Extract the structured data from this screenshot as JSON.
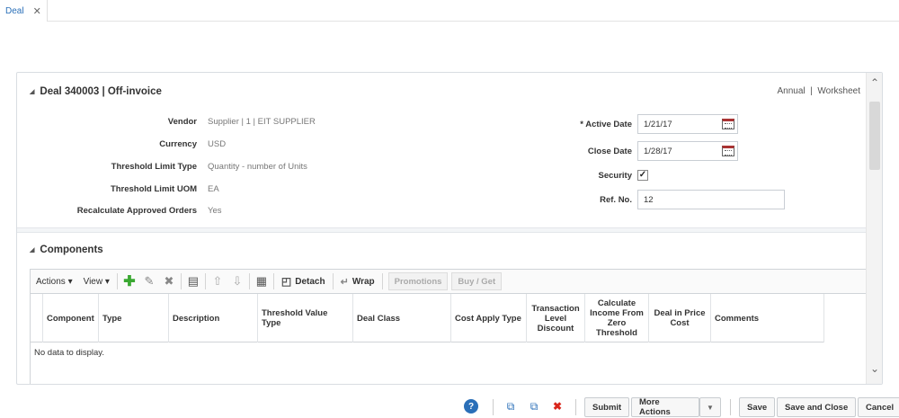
{
  "tab": {
    "label": "Deal",
    "close": "✕"
  },
  "deal": {
    "header": "Deal 340003  |  Off-invoice",
    "links": [
      "Annual",
      "Worksheet"
    ],
    "link_sep": "|"
  },
  "fields": {
    "vendor": {
      "label": "Vendor",
      "value": "Supplier  |  1  |  EIT SUPPLIER"
    },
    "currency": {
      "label": "Currency",
      "value": "USD"
    },
    "threshold_type": {
      "label": "Threshold Limit Type",
      "value": "Quantity - number of Units"
    },
    "threshold_uom": {
      "label": "Threshold Limit UOM",
      "value": "EA"
    },
    "recalc": {
      "label": "Recalculate Approved Orders",
      "value": "Yes"
    },
    "active_date": {
      "label": "* Active Date",
      "value": "1/21/17"
    },
    "close_date": {
      "label": "Close Date",
      "value": "1/28/17"
    },
    "security": {
      "label": "Security",
      "value": "✓"
    },
    "ref_no": {
      "label": "Ref. No.",
      "value": "12"
    }
  },
  "components": {
    "title": "Components",
    "toolbar": {
      "actions": "Actions ▾",
      "view": "View ▾",
      "detach": "Detach",
      "wrap": "Wrap",
      "promotions": "Promotions",
      "buy_get": "Buy / Get"
    },
    "columns": [
      "Component",
      "Type",
      "Description",
      "Threshold Value Type",
      "Deal Class",
      "Cost Apply Type",
      "Transaction Level Discount",
      "Calculate Income From Zero Threshold",
      "Deal in Price Cost",
      "Comments"
    ],
    "empty": "No data to display."
  },
  "footer": {
    "submit": "Submit",
    "more_actions": "More Actions",
    "save": "Save",
    "save_close": "Save and Close",
    "cancel": "Cancel"
  },
  "colors": {
    "link": "#2a6fb8",
    "add": "#3aa832",
    "delete": "#d9261c"
  },
  "icons": [
    "help-icon",
    "copy-icon",
    "paste-icon",
    "delete-icon",
    "add-icon",
    "edit-icon",
    "remove-icon",
    "export-icon",
    "move-up-icon",
    "move-down-icon",
    "detach-icon",
    "wrap-icon",
    "calendar-icon",
    "checkbox-icon",
    "scroll-up-icon",
    "scroll-down-icon"
  ]
}
